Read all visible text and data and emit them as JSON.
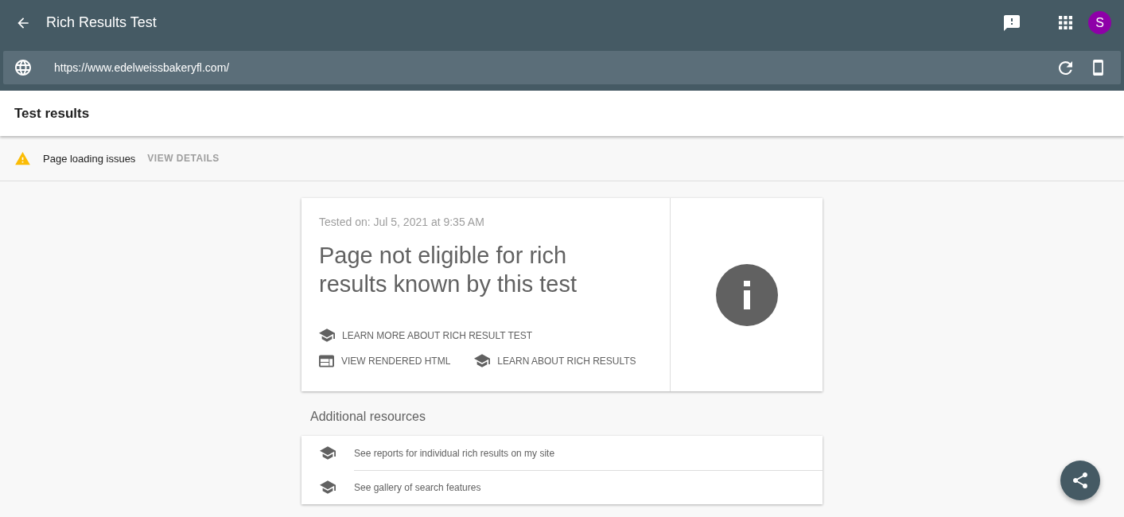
{
  "app_bar": {
    "title": "Rich Results Test",
    "avatar_initial": "S"
  },
  "url_bar": {
    "value": "https://www.edelweissbakeryfl.com/"
  },
  "section_title": "Test results",
  "issues_bar": {
    "message": "Page loading issues",
    "action": "VIEW DETAILS"
  },
  "result_card": {
    "tested_on": "Tested on: Jul 5, 2021 at 9:35 AM",
    "headline": "Page not eligible for rich results known by this test",
    "link_rows": [
      [
        {
          "kind": "school",
          "label": "LEARN MORE ABOUT RICH RESULT TEST"
        }
      ],
      [
        {
          "kind": "html",
          "label": "VIEW RENDERED HTML"
        },
        {
          "kind": "school",
          "label": "LEARN ABOUT RICH RESULTS"
        }
      ]
    ]
  },
  "additional_resources": {
    "title": "Additional resources",
    "items": [
      {
        "label": "See reports for individual rich results on my site"
      },
      {
        "label": "See gallery of search features"
      }
    ]
  }
}
